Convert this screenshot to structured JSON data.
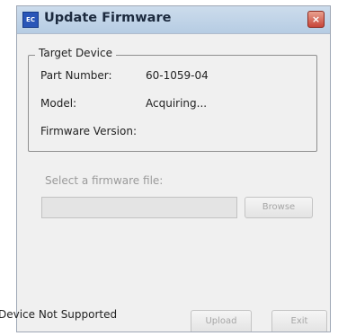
{
  "window": {
    "title": "Update Firmware",
    "icon_text": "EC",
    "close_glyph": "×"
  },
  "target_device": {
    "legend": "Target Device",
    "part_number_label": "Part Number:",
    "part_number_value": "60-1059-04",
    "model_label": "Model:",
    "model_value": "Acquiring...",
    "firmware_label": "Firmware Version:",
    "firmware_value": ""
  },
  "file_select": {
    "label": "Select a firmware file:",
    "value": "",
    "browse_label": "Browse"
  },
  "footer": {
    "status": "Device Not Supported",
    "upload_label": "Upload",
    "exit_label": "Exit"
  },
  "colors": {
    "titlebar": "#b6cce3",
    "close_button": "#c7463a",
    "app_icon": "#2a56b8",
    "disabled_text": "#a6a6a6"
  }
}
